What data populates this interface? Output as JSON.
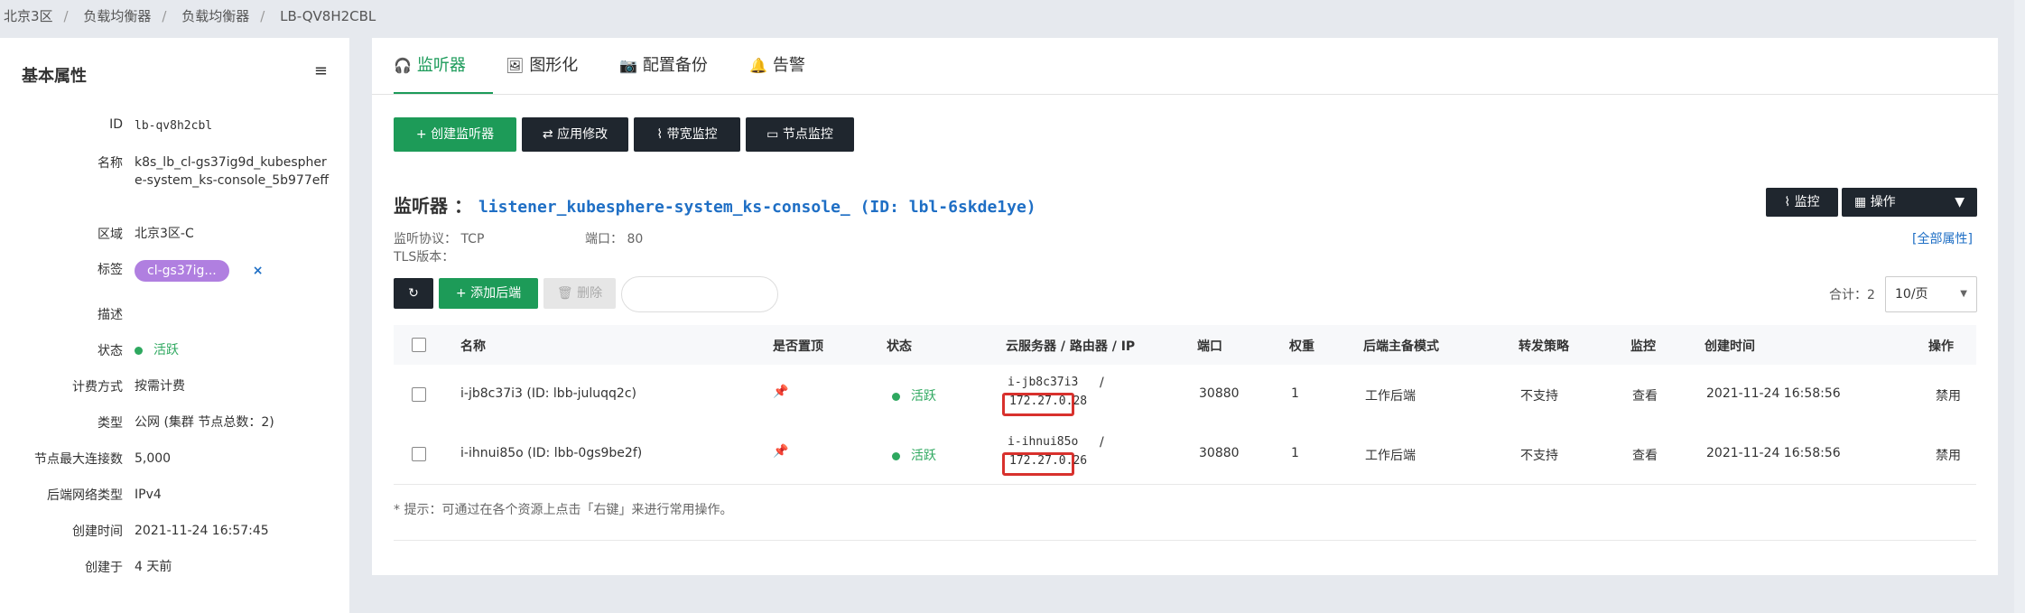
{
  "breadcrumb": [
    "北京3区",
    "负载均衡器",
    "负载均衡器",
    "LB-QV8H2CBL"
  ],
  "left": {
    "title": "基本属性",
    "props": [
      {
        "k": "ID",
        "v": "lb-qv8h2cbl"
      },
      {
        "k": "名称",
        "v": "k8s_lb_cl-gs37ig9d_kubesphere-system_ks-console_5b977eff"
      },
      {
        "k": "区域",
        "v": "北京3区-C"
      },
      {
        "k": "标签",
        "v": "cl-gs37ig...",
        "x": "×"
      },
      {
        "k": "描述",
        "v": ""
      },
      {
        "k": "状态",
        "v": "活跃"
      },
      {
        "k": "计费方式",
        "v": "按需计费"
      },
      {
        "k": "类型",
        "v": "公网 (集群 节点总数：2)"
      },
      {
        "k": "节点最大连接数",
        "v": "5,000"
      },
      {
        "k": "后端网络类型",
        "v": "IPv4"
      },
      {
        "k": "创建时间",
        "v": "2021-11-24 16:57:45"
      },
      {
        "k": "创建于",
        "v": "4 天前"
      }
    ]
  },
  "tabs": [
    {
      "label": "监听器",
      "icon": "headphones-icon"
    },
    {
      "label": "图形化",
      "icon": "image-icon"
    },
    {
      "label": "配置备份",
      "icon": "camera-icon"
    },
    {
      "label": "告警",
      "icon": "bell-icon"
    }
  ],
  "toolbar": {
    "create": "+ 创建监听器",
    "apply": "应用修改",
    "bandwidth": "带宽监控",
    "node_monitor": "节点监控"
  },
  "listener": {
    "label": "监听器 ：",
    "name": "listener_kubesphere-system_ks-console_ (ID: lbl-6skde1ye)",
    "protocol_label": "监听协议：",
    "protocol": "TCP",
    "port_label": "端口：",
    "port": "80",
    "tls_label": "TLS版本：",
    "monitor_btn": "监控",
    "ops_btn": "操作",
    "all_props": "[全部属性]"
  },
  "actions": {
    "add_backend": "+ 添加后端",
    "delete": "删除",
    "total": "合计：2",
    "per_page": "10/页"
  },
  "table": {
    "headers": [
      "名称",
      "是否置顶",
      "状态",
      "云服务器 / 路由器 / IP",
      "端口",
      "权重",
      "后端主备模式",
      "转发策略",
      "监控",
      "创建时间",
      "操作"
    ],
    "rows": [
      {
        "name": "i-jb8c37i3 (ID: lbb-juluqq2c)",
        "status": "活跃",
        "server": "i-jb8c37i3",
        "sep": "/",
        "ip": "172.27.0.28",
        "port": "30880",
        "weight": "1",
        "mode": "工作后端",
        "policy": "不支持",
        "monitor": "查看",
        "created": "2021-11-24 16:58:56",
        "op": "禁用"
      },
      {
        "name": "i-ihnui85o (ID: lbb-0gs9be2f)",
        "status": "活跃",
        "server": "i-ihnui85o",
        "sep": "/",
        "ip": "172.27.0.26",
        "port": "30880",
        "weight": "1",
        "mode": "工作后端",
        "policy": "不支持",
        "monitor": "查看",
        "created": "2021-11-24 16:58:56",
        "op": "禁用"
      }
    ]
  },
  "hint": "* 提示：可通过在各个资源上点击「右键」来进行常用操作。",
  "colors": {
    "accent": "#1d9b58",
    "link": "#1f6fc5",
    "dark_button": "#1f262e",
    "tag": "#b07fe0",
    "highlight_box": "#d8312d"
  }
}
